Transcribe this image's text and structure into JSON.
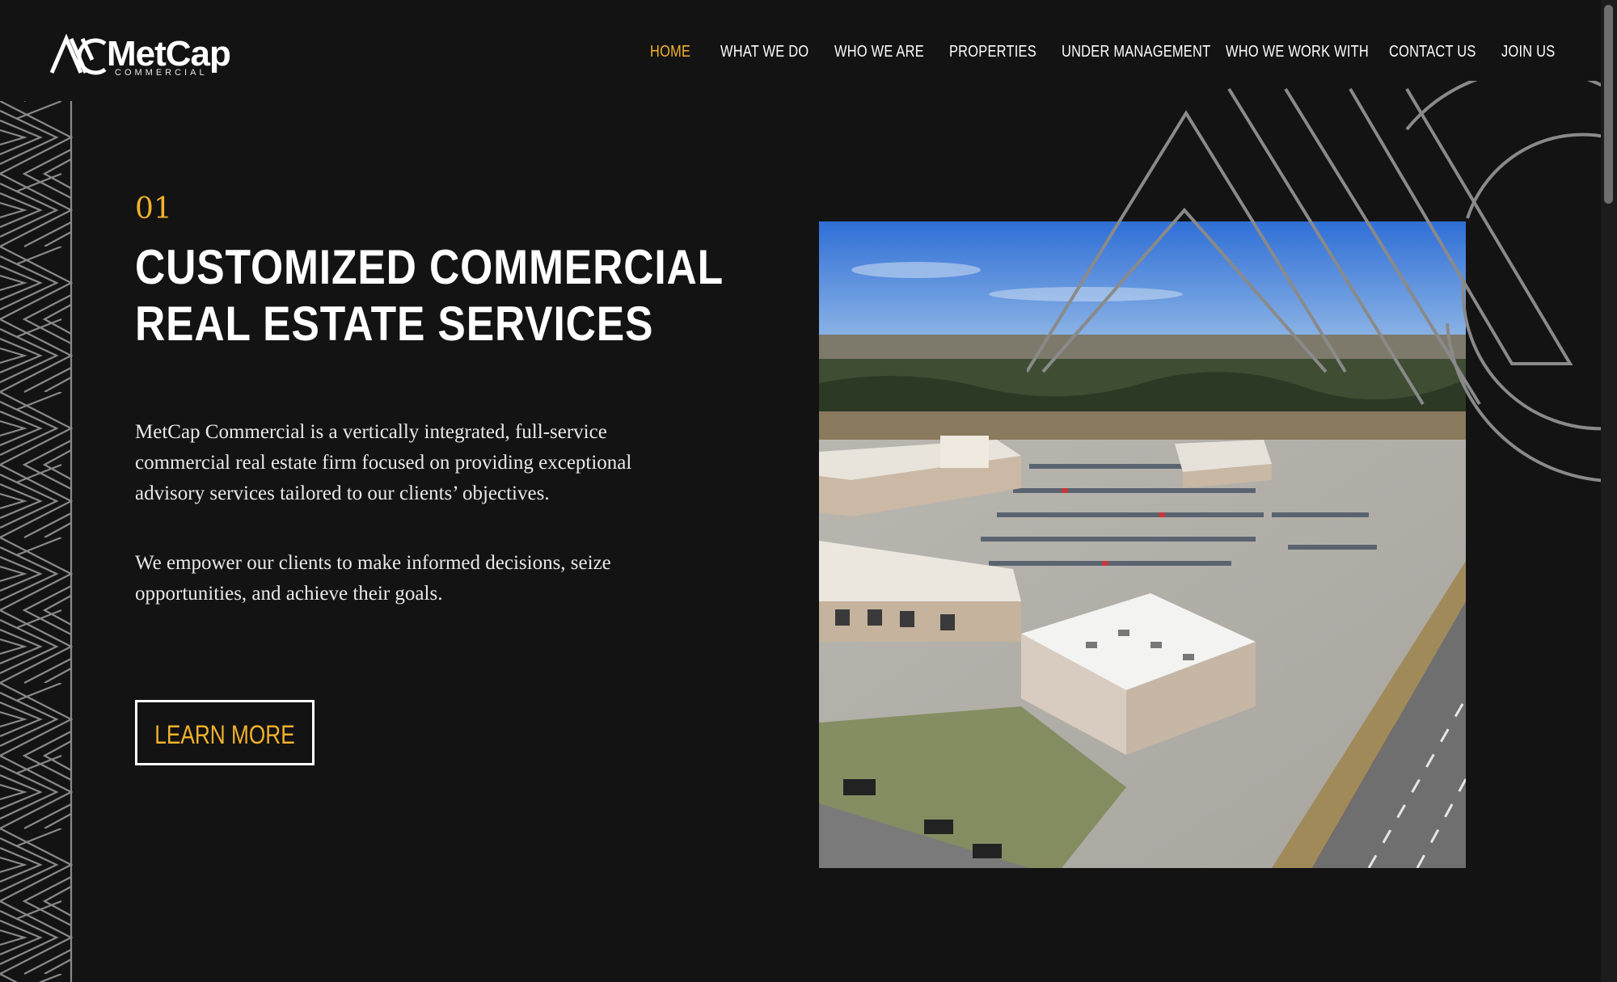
{
  "brand": {
    "name": "MetCap",
    "subtitle": "COMMERCIAL",
    "accent_color": "#f2b22b",
    "background_color": "#131313"
  },
  "nav": {
    "items": [
      {
        "label": "HOME",
        "active": true
      },
      {
        "label": "WHAT WE DO",
        "active": false
      },
      {
        "label": "WHO WE ARE",
        "active": false
      },
      {
        "label": "PROPERTIES",
        "active": false
      },
      {
        "label": "UNDER MANAGEMENT",
        "active": false
      },
      {
        "label": "WHO WE WORK WITH",
        "active": false
      },
      {
        "label": "CONTACT US",
        "active": false
      },
      {
        "label": "JOIN US",
        "active": false
      }
    ]
  },
  "hero": {
    "number": "01",
    "title_line1": "CUSTOMIZED COMMERCIAL",
    "title_line2": "REAL ESTATE SERVICES",
    "paragraph1": "MetCap Commercial is a vertically integrated, full-service commercial real estate firm focused on providing exceptional advisory services tailored to our clients’ objectives.",
    "paragraph2": "We empower our clients to make informed decisions, seize opportunities, and achieve their goals.",
    "cta_label": "LEARN MORE"
  },
  "icons": {
    "logo": "metcap-logo-icon",
    "pattern": "zigzag-pattern-icon",
    "deco": "metcap-monogram-outline-icon"
  }
}
